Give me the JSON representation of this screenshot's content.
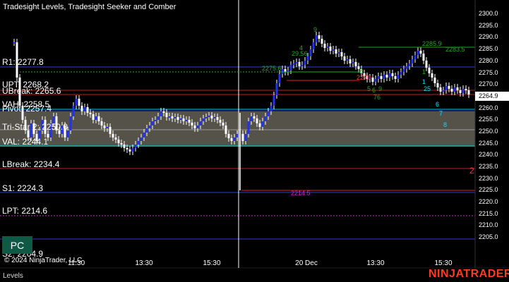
{
  "window": {
    "title": "Tradesight Levels, Tradesight Seeker and Comber",
    "copyright": "© 2024 NinjaTrader, LLC",
    "brand": "NINJATRADER",
    "tab": "Levels",
    "badge": "PC"
  },
  "price_axis": {
    "labels": [
      "2300.0",
      "2295.0",
      "2290.0",
      "2285.0",
      "2280.0",
      "2275.0",
      "2270.0",
      "2264.9",
      "2260.0",
      "2255.0",
      "2250.0",
      "2245.0",
      "2240.0",
      "2235.0",
      "2230.0",
      "2225.0",
      "2220.0",
      "2215.0",
      "2210.0",
      "2205.0"
    ],
    "current_price": "2264.9"
  },
  "time_axis": {
    "labels": [
      "11:30",
      "13:30",
      "15:30",
      "20 Dec",
      "13:30",
      "15:30"
    ]
  },
  "levels": [
    {
      "name": "r1",
      "label": "R1: 2277.8",
      "color": "#2a3fd4"
    },
    {
      "name": "upt",
      "label": "UPT: 2268.2",
      "color": "#c02020"
    },
    {
      "name": "ubreak",
      "label": "UBreak: 2265.6",
      "color": "#c02020"
    },
    {
      "name": "vah",
      "label": "VAH: 2258.5",
      "color": "#00c8e0"
    },
    {
      "name": "pivot",
      "label": "Pivot: 2257.4",
      "color": "#2a3fd4"
    },
    {
      "name": "tri-star",
      "label": "Tri-Star 2: 2250.0",
      "color": "#999999"
    },
    {
      "name": "val",
      "label": "VAL: 2244.1",
      "color": "#00c8e0"
    },
    {
      "name": "lbreak",
      "label": "LBreak: 2234.4",
      "color": "#c02020"
    },
    {
      "name": "s1",
      "label": "S1: 2224.3",
      "color": "#2a3fd4"
    },
    {
      "name": "lpt",
      "label": "LPT: 2214.6",
      "color": "#d020d0"
    },
    {
      "name": "s2",
      "label": "S2: 2204.9",
      "color": "#2a3fd4"
    }
  ],
  "markers": [
    {
      "text": "2275.6",
      "color": "#22a822"
    },
    {
      "text": "2285.9",
      "color": "#22a822"
    },
    {
      "text": "2283.5",
      "color": "#22a822"
    },
    {
      "text": "2214.5",
      "color": "#d020d0"
    },
    {
      "text": "2",
      "color": "#ff3030"
    },
    {
      "text": "9",
      "color": "#22a822"
    },
    {
      "text": "4",
      "color": "#22a822"
    },
    {
      "text": "29.56",
      "color": "#22a822"
    },
    {
      "text": "8",
      "color": "#22a822"
    },
    {
      "text": "2270",
      "color": "#ff3030"
    },
    {
      "text": "5",
      "color": "#22a822"
    },
    {
      "text": "6",
      "color": "#22a822"
    },
    {
      "text": "9",
      "color": "#22a822"
    },
    {
      "text": "76",
      "color": "#22a822"
    },
    {
      "text": "1",
      "color": "#22a822"
    },
    {
      "text": "1",
      "color": "#00e0ff"
    },
    {
      "text": "25",
      "color": "#00e0ff"
    },
    {
      "text": "6",
      "color": "#00e0ff"
    },
    {
      "text": "7",
      "color": "#00e0ff"
    },
    {
      "text": "8",
      "color": "#00e0ff"
    }
  ]
}
